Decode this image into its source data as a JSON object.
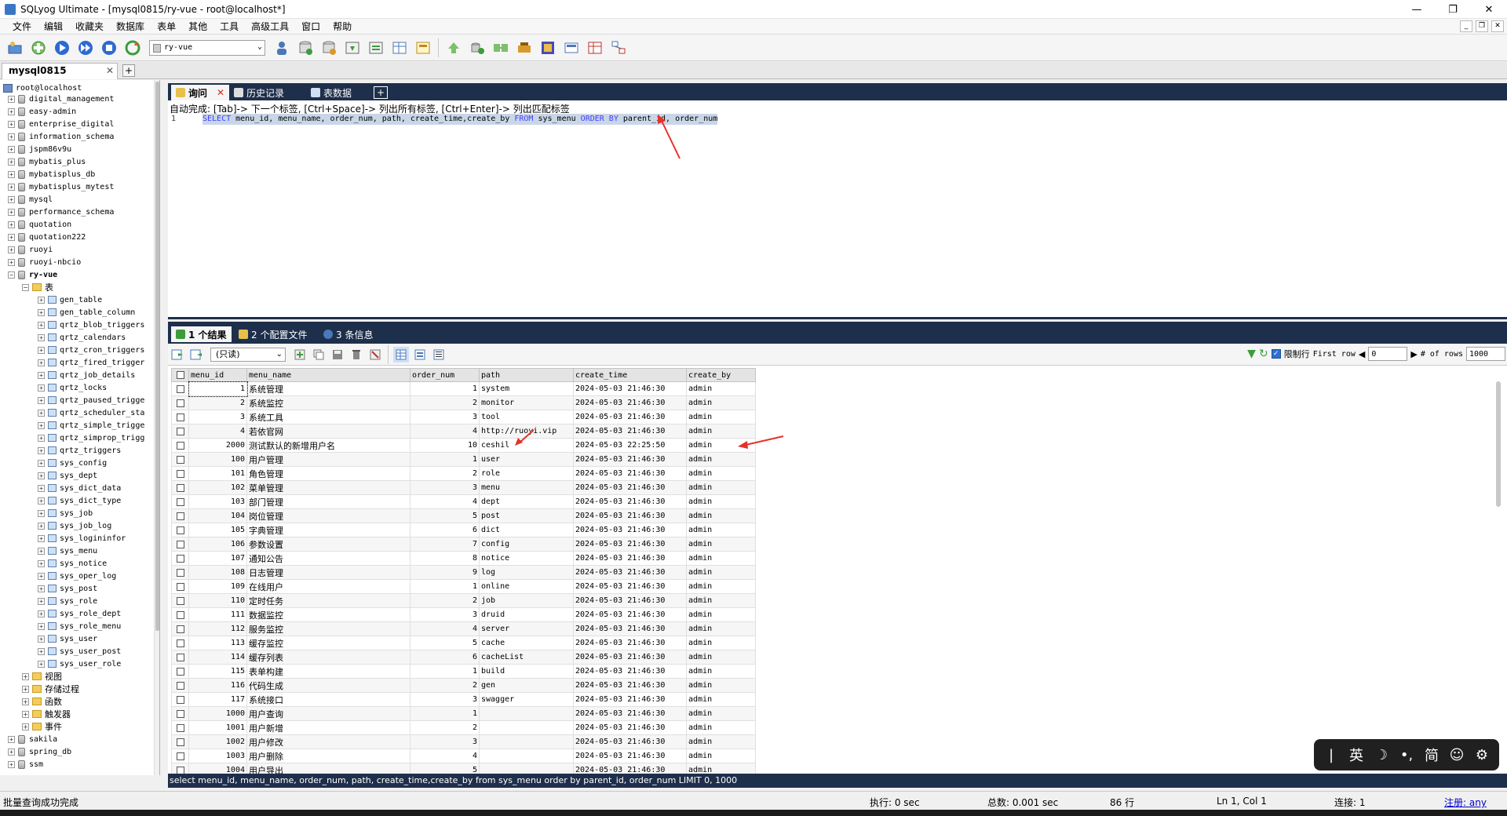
{
  "window": {
    "title": "SQLyog Ultimate - [mysql0815/ry-vue - root@localhost*]",
    "controls": [
      "—",
      "❐",
      "✕"
    ]
  },
  "menu": [
    "文件",
    "编辑",
    "收藏夹",
    "数据库",
    "表单",
    "其他",
    "工具",
    "高级工具",
    "窗口",
    "帮助"
  ],
  "mdi_controls": [
    "_",
    "❐",
    "✕"
  ],
  "toolbar": {
    "db_selected": "ry-vue"
  },
  "connection_tab": {
    "label": "mysql0815",
    "close": "✕",
    "add": "+"
  },
  "object_browser": {
    "root": "root@localhost",
    "databases_before": [
      "digital_management",
      "easy-admin",
      "enterprise_digital",
      "information_schema",
      "jspm86v9u",
      "mybatis_plus",
      "mybatisplus_db",
      "mybatisplus_mytest",
      "mysql",
      "performance_schema",
      "quotation",
      "quotation222",
      "ruoyi",
      "ruoyi-nbcio"
    ],
    "expanded_db": "ry-vue",
    "tables_folder": "表",
    "tables": [
      "gen_table",
      "gen_table_column",
      "qrtz_blob_triggers",
      "qrtz_calendars",
      "qrtz_cron_triggers",
      "qrtz_fired_trigger",
      "qrtz_job_details",
      "qrtz_locks",
      "qrtz_paused_trigge",
      "qrtz_scheduler_sta",
      "qrtz_simple_trigge",
      "qrtz_simprop_trigg",
      "qrtz_triggers",
      "sys_config",
      "sys_dept",
      "sys_dict_data",
      "sys_dict_type",
      "sys_job",
      "sys_job_log",
      "sys_logininfor",
      "sys_menu",
      "sys_notice",
      "sys_oper_log",
      "sys_post",
      "sys_role",
      "sys_role_dept",
      "sys_role_menu",
      "sys_user",
      "sys_user_post",
      "sys_user_role"
    ],
    "other_folders": [
      "视图",
      "存储过程",
      "函数",
      "触发器",
      "事件"
    ],
    "databases_after": [
      "sakila",
      "spring_db",
      "ssm"
    ]
  },
  "query_tabs": [
    {
      "label": "询问",
      "close": "✕"
    },
    {
      "label": "历史记录"
    },
    {
      "label": "表数据"
    }
  ],
  "query_tab_add": "+",
  "editor": {
    "hint": "自动完成: [Tab]-> 下一个标签, [Ctrl+Space]-> 列出所有标签, [Ctrl+Enter]-> 列出匹配标签",
    "line_no": "1",
    "sql_kw1": "SELECT",
    "sql_p1": " menu_id, menu_name, order_num, path, create_time,create_by ",
    "sql_kw2": "FROM",
    "sql_p2": " sys_menu ",
    "sql_kw3": "ORDER BY",
    "sql_p3": " parent_id, order_num"
  },
  "result_tabs": [
    "1 个结果",
    "2 个配置文件",
    "3 条信息"
  ],
  "grid_toolbar": {
    "mode": "(只读)",
    "limit_label": "限制行",
    "first_row_label": "First row",
    "first_row_value": "0",
    "rows_label": "# of rows",
    "rows_value": "1000"
  },
  "grid": {
    "columns": [
      "menu_id",
      "menu_name",
      "order_num",
      "path",
      "create_time",
      "create_by"
    ],
    "rows": [
      [
        "1",
        "系统管理",
        "1",
        "system",
        "2024-05-03 21:46:30",
        "admin"
      ],
      [
        "2",
        "系统监控",
        "2",
        "monitor",
        "2024-05-03 21:46:30",
        "admin"
      ],
      [
        "3",
        "系统工具",
        "3",
        "tool",
        "2024-05-03 21:46:30",
        "admin"
      ],
      [
        "4",
        "若依官网",
        "4",
        "http://ruoyi.vip",
        "2024-05-03 21:46:30",
        "admin"
      ],
      [
        "2000",
        "测试默认的新增用户名",
        "10",
        "ceshil",
        "2024-05-03 22:25:50",
        "admin"
      ],
      [
        "100",
        "用户管理",
        "1",
        "user",
        "2024-05-03 21:46:30",
        "admin"
      ],
      [
        "101",
        "角色管理",
        "2",
        "role",
        "2024-05-03 21:46:30",
        "admin"
      ],
      [
        "102",
        "菜单管理",
        "3",
        "menu",
        "2024-05-03 21:46:30",
        "admin"
      ],
      [
        "103",
        "部门管理",
        "4",
        "dept",
        "2024-05-03 21:46:30",
        "admin"
      ],
      [
        "104",
        "岗位管理",
        "5",
        "post",
        "2024-05-03 21:46:30",
        "admin"
      ],
      [
        "105",
        "字典管理",
        "6",
        "dict",
        "2024-05-03 21:46:30",
        "admin"
      ],
      [
        "106",
        "参数设置",
        "7",
        "config",
        "2024-05-03 21:46:30",
        "admin"
      ],
      [
        "107",
        "通知公告",
        "8",
        "notice",
        "2024-05-03 21:46:30",
        "admin"
      ],
      [
        "108",
        "日志管理",
        "9",
        "log",
        "2024-05-03 21:46:30",
        "admin"
      ],
      [
        "109",
        "在线用户",
        "1",
        "online",
        "2024-05-03 21:46:30",
        "admin"
      ],
      [
        "110",
        "定时任务",
        "2",
        "job",
        "2024-05-03 21:46:30",
        "admin"
      ],
      [
        "111",
        "数据监控",
        "3",
        "druid",
        "2024-05-03 21:46:30",
        "admin"
      ],
      [
        "112",
        "服务监控",
        "4",
        "server",
        "2024-05-03 21:46:30",
        "admin"
      ],
      [
        "113",
        "缓存监控",
        "5",
        "cache",
        "2024-05-03 21:46:30",
        "admin"
      ],
      [
        "114",
        "缓存列表",
        "6",
        "cacheList",
        "2024-05-03 21:46:30",
        "admin"
      ],
      [
        "115",
        "表单构建",
        "1",
        "build",
        "2024-05-03 21:46:30",
        "admin"
      ],
      [
        "116",
        "代码生成",
        "2",
        "gen",
        "2024-05-03 21:46:30",
        "admin"
      ],
      [
        "117",
        "系统接口",
        "3",
        "swagger",
        "2024-05-03 21:46:30",
        "admin"
      ],
      [
        "1000",
        "用户查询",
        "1",
        "",
        "2024-05-03 21:46:30",
        "admin"
      ],
      [
        "1001",
        "用户新增",
        "2",
        "",
        "2024-05-03 21:46:30",
        "admin"
      ],
      [
        "1002",
        "用户修改",
        "3",
        "",
        "2024-05-03 21:46:30",
        "admin"
      ],
      [
        "1003",
        "用户删除",
        "4",
        "",
        "2024-05-03 21:46:30",
        "admin"
      ],
      [
        "1004",
        "用户导出",
        "5",
        "",
        "2024-05-03 21:46:30",
        "admin"
      ]
    ]
  },
  "result_sql": "select menu_id, menu_name, order_num, path, create_time,create_by from sys_menu order by parent_id, order_num LIMIT 0, 1000",
  "status": {
    "message": "批量查询成功完成",
    "exec": "执行: 0 sec",
    "total": "总数: 0.001 sec",
    "rows": "86 行",
    "pos": "Ln 1, Col 1",
    "conn": "连接: 1",
    "register": "注册: any"
  },
  "ime": [
    "|",
    "英",
    "☽",
    "•,",
    "简",
    "☺",
    "⚙"
  ],
  "colors": {
    "tab_bar": "#1e2f4b",
    "keyword": "#4040ff",
    "annotation_arrow": "#e8302a"
  }
}
